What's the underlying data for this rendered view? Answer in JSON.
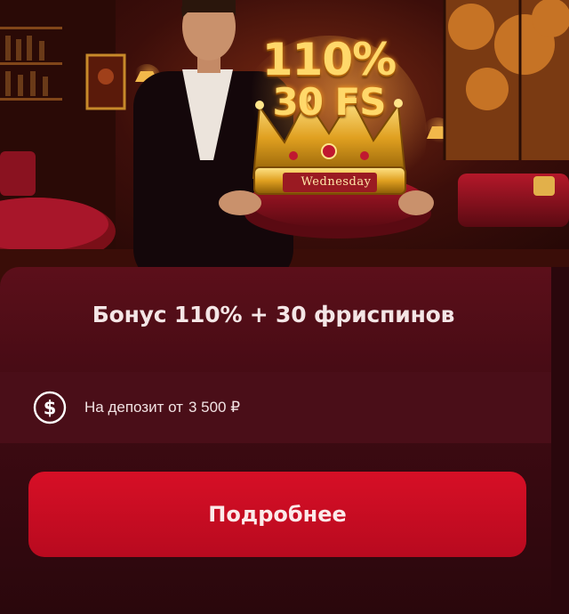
{
  "banner": {
    "headline_line_1": "110%",
    "headline_line_2": "30 FS",
    "ribbon_text": "Wednesday",
    "colors": {
      "gold": "#ffd86a",
      "velvet": "#8e0f1c",
      "background": "#3c0e0a"
    }
  },
  "offer": {
    "title": "Бонус 110% + 30 фриспинов",
    "deposit_label": "На депозит от",
    "deposit_amount": "3 500 ₽",
    "deposit_icon": "dollar-coin-icon"
  },
  "actions": {
    "details_label": "Подробнее"
  },
  "theme": {
    "panel_color": "#5c0f1a",
    "row_color": "#4a0e18",
    "button_color": "#d70f26",
    "text_color": "#f4e6e6"
  }
}
